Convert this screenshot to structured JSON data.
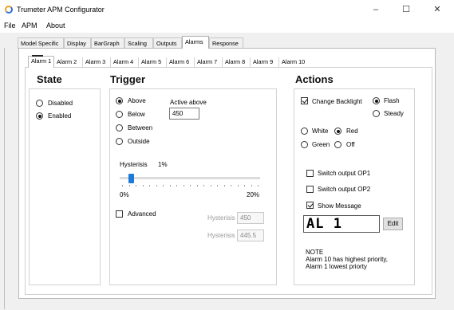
{
  "window": {
    "title": "Trumeter APM Configurator",
    "minimize": "–",
    "maximize": "☐",
    "close": "✕",
    "icon": "app-ring-icon"
  },
  "menu": [
    "File",
    "APM",
    "About"
  ],
  "top_tabs": [
    "Model Specific",
    "Display",
    "BarGraph",
    "Scaling",
    "Outputs",
    "Alarms",
    "Response"
  ],
  "top_tab_selected": "Alarms",
  "alarm_tabs": [
    "Alarm 1",
    "Alarm 2",
    "Alarm 3",
    "Alarm 4",
    "Alarm 5",
    "Alarm 6",
    "Alarm 7",
    "Alarm 8",
    "Alarm 9",
    "Alarm 10"
  ],
  "alarm_tab_selected": "Alarm 1",
  "state": {
    "title": "State",
    "options": [
      "Disabled",
      "Enabled"
    ],
    "selected": "Enabled"
  },
  "trigger": {
    "title": "Trigger",
    "options": [
      "Above",
      "Below",
      "Between",
      "Outside"
    ],
    "selected": "Above",
    "active_label": "Active above",
    "active_value": "450",
    "hysteresis_label": "Hysterisis",
    "hysteresis_value": "1%",
    "slider_min": "0%",
    "slider_max": "20%",
    "slider_fraction": 0.05,
    "advanced_label": "Advanced",
    "advanced_checked": false,
    "adv_hyst1_label": "Hysterisis",
    "adv_hyst1_value": "450",
    "adv_hyst2_label": "Hysterisis",
    "adv_hyst2_value": "445.5"
  },
  "actions": {
    "title": "Actions",
    "change_backlight_label": "Change Backlight",
    "change_backlight_checked": true,
    "flash_label": "Flash",
    "steady_label": "Steady",
    "flash_selected": "Flash",
    "white_label": "White",
    "red_label": "Red",
    "green_label": "Green",
    "off_label": "Off",
    "color_selected": "Red",
    "switch_op1_label": "Switch output OP1",
    "switch_op1_checked": false,
    "switch_op2_label": "Switch output OP2",
    "switch_op2_checked": false,
    "show_message_label": "Show Message",
    "show_message_checked": true,
    "message_text": "AL 1",
    "edit_label": "Edit",
    "note_title": "NOTE",
    "note_line1": "Alarm 10 has highest priority,",
    "note_line2": "Alarm 1 lowest priorty"
  },
  "colors": {
    "slider_thumb": "#1e7ad8",
    "panel_bg": "#ffffff",
    "client_bg": "#f0f0f0"
  }
}
